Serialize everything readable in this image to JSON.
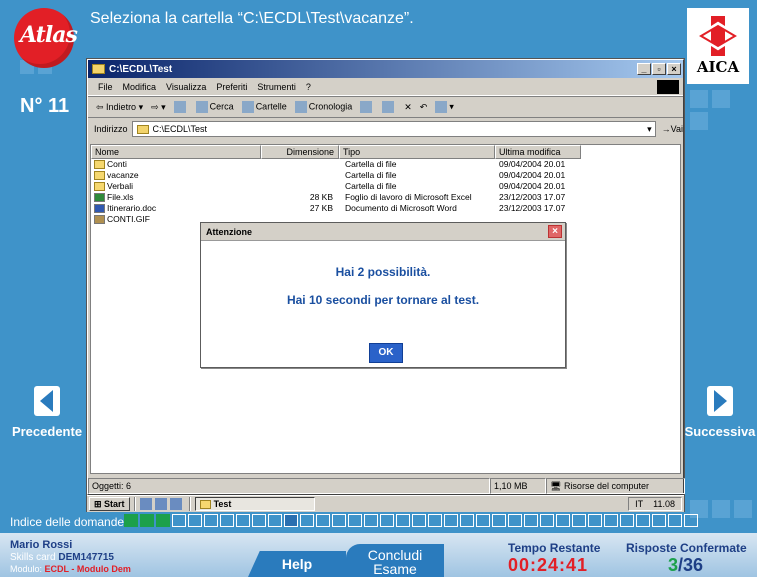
{
  "instruction": "Seleziona la cartella “C:\\ECDL\\Test\\vacanze”.",
  "question_number": "N° 11",
  "logos": {
    "atlas": "Atlas",
    "aica": "AICA"
  },
  "nav": {
    "prev_label": "Precedente",
    "next_label": "Successiva"
  },
  "window": {
    "title": "C:\\ECDL\\Test",
    "menu": [
      "File",
      "Modifica",
      "Visualizza",
      "Preferiti",
      "Strumenti",
      "?"
    ],
    "toolbar": [
      "Indietro",
      "Cerca",
      "Cartelle",
      "Cronologia"
    ],
    "address_label": "Indirizzo",
    "address_value": "C:\\ECDL\\Test",
    "go_label": "Vai",
    "columns": {
      "name": "Nome",
      "size": "Dimensione",
      "type": "Tipo",
      "modified": "Ultima modifica"
    },
    "files": [
      {
        "name": "Conti",
        "size": "",
        "type": "Cartella di file",
        "modified": "09/04/2004 20.01",
        "icon": "folder"
      },
      {
        "name": "vacanze",
        "size": "",
        "type": "Cartella di file",
        "modified": "09/04/2004 20.01",
        "icon": "folder"
      },
      {
        "name": "Verbali",
        "size": "",
        "type": "Cartella di file",
        "modified": "09/04/2004 20.01",
        "icon": "folder"
      },
      {
        "name": "File.xls",
        "size": "28 KB",
        "type": "Foglio di lavoro di Microsoft Excel",
        "modified": "23/12/2003 17.07",
        "icon": "xls"
      },
      {
        "name": "Itinerario.doc",
        "size": "27 KB",
        "type": "Documento di Microsoft Word",
        "modified": "23/12/2003 17.07",
        "icon": "doc"
      },
      {
        "name": "CONTI.GIF",
        "size": "",
        "type": "",
        "modified": "",
        "icon": "gif"
      }
    ],
    "status_objects": "Oggetti: 6",
    "status_size": "1,10 MB",
    "status_location": "Risorse del computer"
  },
  "taskbar": {
    "start": "Start",
    "task": "Test",
    "lang": "IT",
    "clock": "11.08"
  },
  "dialog": {
    "title": "Attenzione",
    "line1": "Hai 2 possibilità.",
    "line2": "Hai 10 secondi per tornare al test.",
    "ok": "OK"
  },
  "index": {
    "label": "Indice delle domande:",
    "states": [
      "done",
      "done",
      "done",
      "empty",
      "empty",
      "empty",
      "empty",
      "empty",
      "empty",
      "empty",
      "current",
      "empty",
      "empty",
      "empty",
      "empty",
      "empty",
      "empty",
      "empty",
      "empty",
      "empty",
      "empty",
      "empty",
      "empty",
      "empty",
      "empty",
      "empty",
      "empty",
      "empty",
      "empty",
      "empty",
      "empty",
      "empty",
      "empty",
      "empty",
      "empty",
      "empty"
    ]
  },
  "user": {
    "name": "Mario Rossi",
    "card_label": "Skills card",
    "card_value": "DEM147715",
    "module_label": "Modulo:",
    "module_value": "ECDL - Modulo Dem"
  },
  "buttons": {
    "help": "Help",
    "end_line1": "Concludi",
    "end_line2": "Esame"
  },
  "timer": {
    "label": "Tempo Restante",
    "value": "00:24:41"
  },
  "answers": {
    "label": "Risposte Confermate",
    "done": "3",
    "total": "/36"
  },
  "colors": {
    "background": "#3f93c9",
    "accent_red": "#e21f26",
    "done_green": "#1ca04b",
    "dark_blue": "#1e3f86"
  }
}
